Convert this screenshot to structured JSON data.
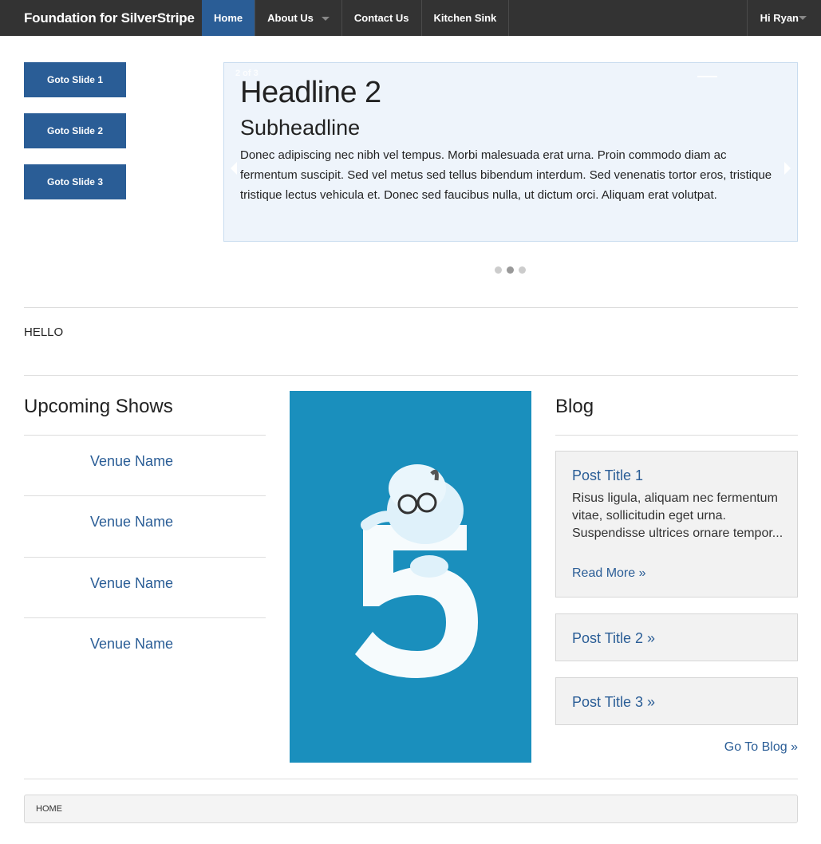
{
  "header": {
    "brand": "Foundation for SilverStripe",
    "nav": [
      {
        "label": "Home",
        "active": true
      },
      {
        "label": "About Us",
        "dropdown": true
      },
      {
        "label": "Contact Us"
      },
      {
        "label": "Kitchen Sink"
      }
    ],
    "user": "Hi Ryan"
  },
  "slider": {
    "buttons": [
      "Goto Slide 1",
      "Goto Slide 2",
      "Goto Slide 3"
    ],
    "counter": "2 of 3",
    "headline": "Headline 2",
    "subheadline": "Subheadline",
    "text": "Donec adipiscing nec nibh vel tempus. Morbi malesuada erat urna. Proin commodo diam ac fermentum suscipit. Sed vel metus sed tellus bibendum interdum. Sed venenatis tortor eros, tristique tristique lectus vehicula et. Donec sed faucibus nulla, ut dictum orci. Aliquam erat volutpat.",
    "active_bullet": 2,
    "bullet_count": 3
  },
  "hello": "HELLO",
  "shows": {
    "title": "Upcoming Shows",
    "venues": [
      "Venue Name",
      "Venue Name",
      "Venue Name",
      "Venue Name"
    ]
  },
  "promo": {
    "number": "5"
  },
  "blog": {
    "title": "Blog",
    "featured": {
      "title": "Post Title 1",
      "excerpt": "Risus ligula, aliquam nec fermentum vitae, sollicitudin eget urna. Suspendisse ultrices ornare tempor...",
      "read_more": "Read More »"
    },
    "posts": [
      "Post Title 2 »",
      "Post Title 3 »"
    ],
    "go_to_blog": "Go To Blog »"
  },
  "breadcrumb": "HOME",
  "colors": {
    "accent": "#2a5d96",
    "topbar": "#333333",
    "promo_bg": "#1a8fbd"
  }
}
